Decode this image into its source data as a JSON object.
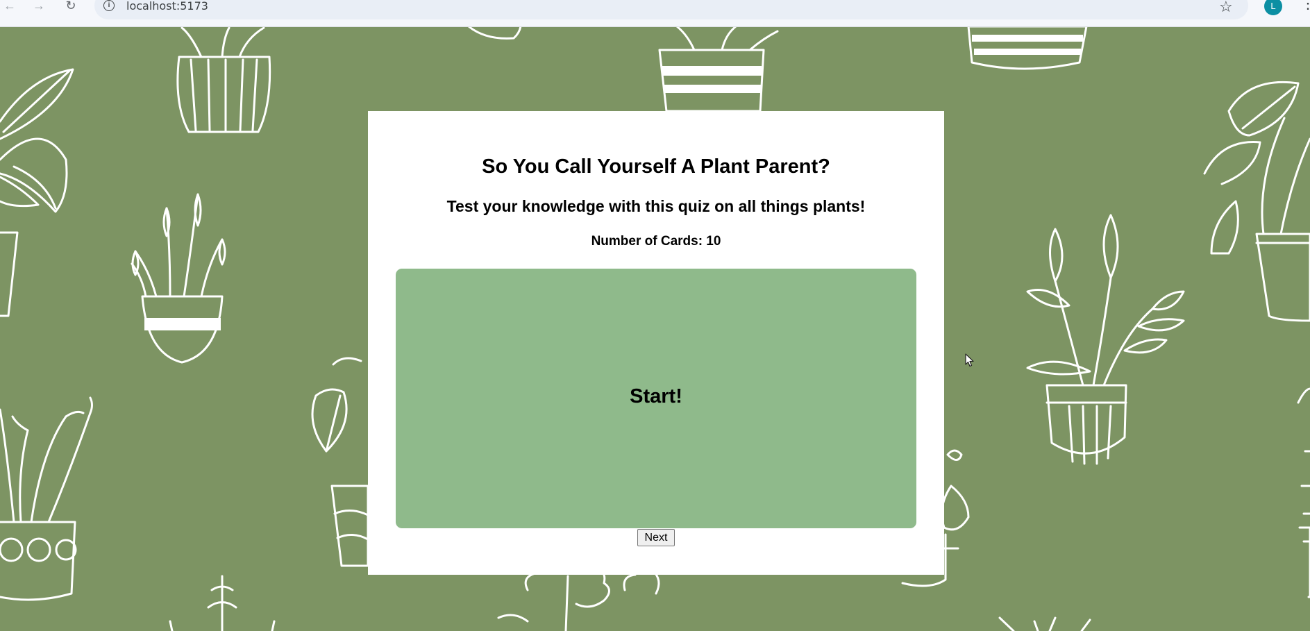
{
  "browser": {
    "url": "localhost:5173",
    "avatar_initial": "L",
    "icons": {
      "back": "arrow-left-icon",
      "forward": "arrow-right-icon",
      "reload": "reload-icon",
      "site_info": "info-icon",
      "bookmark": "star-icon",
      "menu": "kebab-menu-icon"
    }
  },
  "quiz": {
    "title": "So You Call Yourself A Plant Parent?",
    "subtitle": "Test your knowledge with this quiz on all things plants!",
    "card_count_label": "Number of Cards: 10",
    "card": {
      "text": "Start!"
    },
    "next_label": "Next"
  },
  "colors": {
    "background": "#7d9463",
    "card": "#8fba8b",
    "panel": "#ffffff",
    "avatar": "#0c8fa3"
  }
}
